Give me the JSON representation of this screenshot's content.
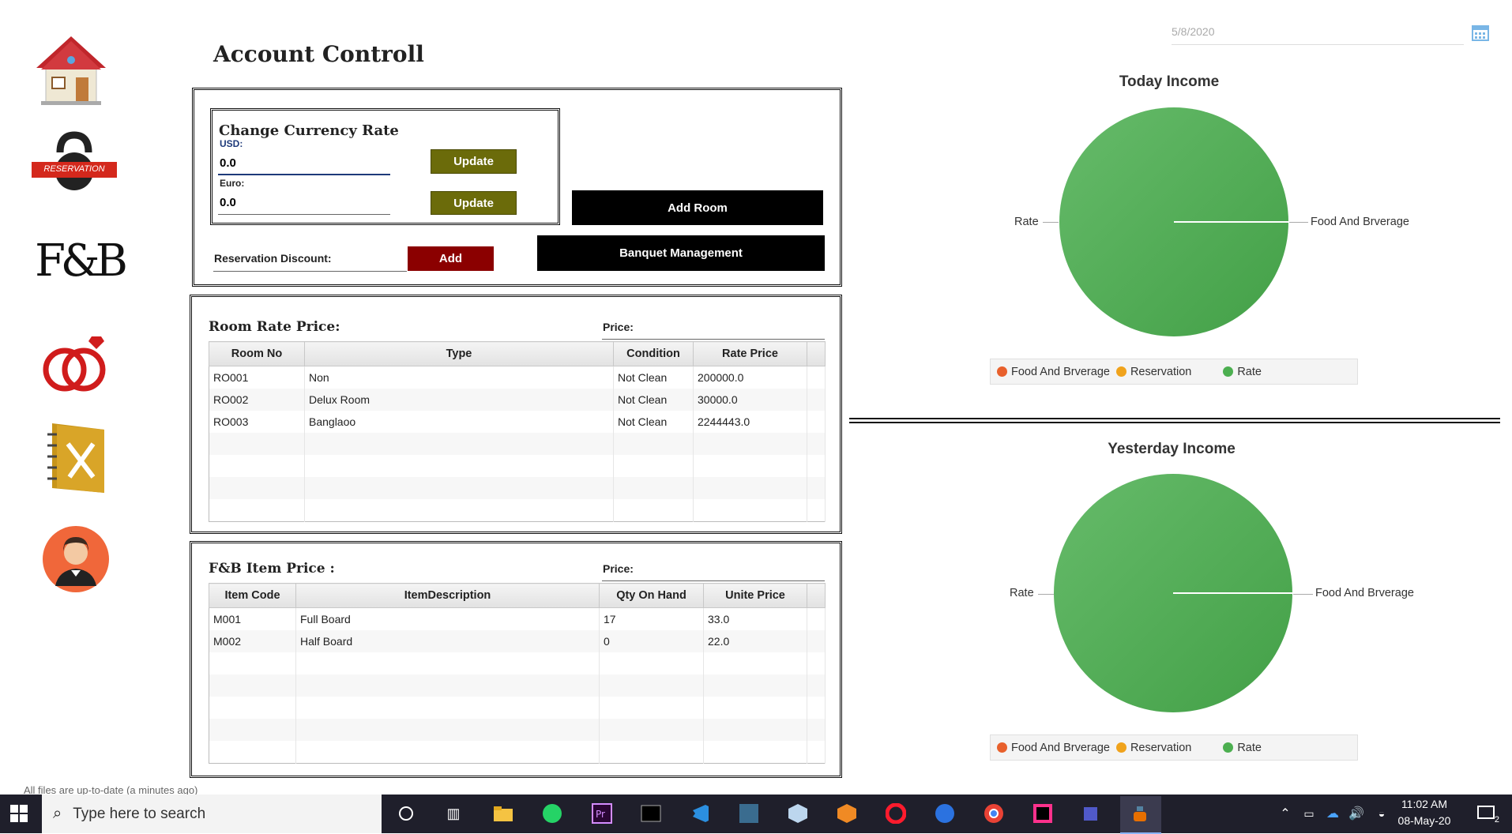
{
  "page_title": "Account Controll",
  "date_picker": {
    "value": "5/8/2020",
    "icon": "calendar-icon"
  },
  "sidebar": {
    "items": [
      {
        "name": "home",
        "icon": "house-icon"
      },
      {
        "name": "reservation",
        "icon": "kettlebell-icon",
        "label": "RESERVATION"
      },
      {
        "name": "fnb",
        "icon": "fnb-logo-icon",
        "label": "F&B"
      },
      {
        "name": "banquet",
        "icon": "rings-icon"
      },
      {
        "name": "menu",
        "icon": "menu-book-icon"
      },
      {
        "name": "staff",
        "icon": "waiter-avatar-icon"
      }
    ]
  },
  "currency": {
    "title": "Change Currency Rate",
    "usd_label": "USD:",
    "usd_value": "0.0",
    "euro_label": "Euro:",
    "euro_value": "0.0",
    "update_label": "Update",
    "update2_label": "Update"
  },
  "discount": {
    "label": "Reservation Discount:",
    "add_label": "Add"
  },
  "actions": {
    "add_room": "Add Room",
    "banquet": "Banquet Management"
  },
  "room_rates": {
    "title": "Room Rate Price:",
    "price_label": "Price:",
    "columns": [
      "Room No",
      "Type",
      "Condition",
      "Rate Price"
    ],
    "rows": [
      [
        "RO001",
        "Non",
        "Not Clean",
        "200000.0"
      ],
      [
        "RO002",
        "Delux Room",
        "Not Clean",
        "30000.0"
      ],
      [
        "RO003",
        "Banglaoo",
        "Not Clean",
        "2244443.0"
      ]
    ]
  },
  "fb_items": {
    "title": "F&B Item Price :",
    "price_label": "Price:",
    "columns": [
      "Item Code",
      "ItemDescription",
      "Qty On Hand",
      "Unite Price"
    ],
    "rows": [
      [
        "M001",
        "Full Board",
        "17",
        "33.0"
      ],
      [
        "M002",
        "Half Board",
        "0",
        "22.0"
      ]
    ]
  },
  "charts": {
    "today": {
      "title": "Today Income",
      "label_left": "Rate",
      "label_right": "Food And Brverage",
      "legend": [
        "Food And Brverage",
        "Reservation",
        "Rate"
      ],
      "colors": [
        "#e8602c",
        "#f0a31c",
        "#4caf50"
      ]
    },
    "yesterday": {
      "title": "Yesterday Income",
      "label_left": "Rate",
      "label_right": "Food And Brverage",
      "legend": [
        "Food And Brverage",
        "Reservation",
        "Rate"
      ],
      "colors": [
        "#e8602c",
        "#f0a31c",
        "#4caf50"
      ]
    }
  },
  "taskbar": {
    "search_placeholder": "Type here to search",
    "time": "11:02 AM",
    "date": "08-May-20",
    "notification_count": "2"
  },
  "status_text": "All files are up-to-date (a minutes ago)"
}
